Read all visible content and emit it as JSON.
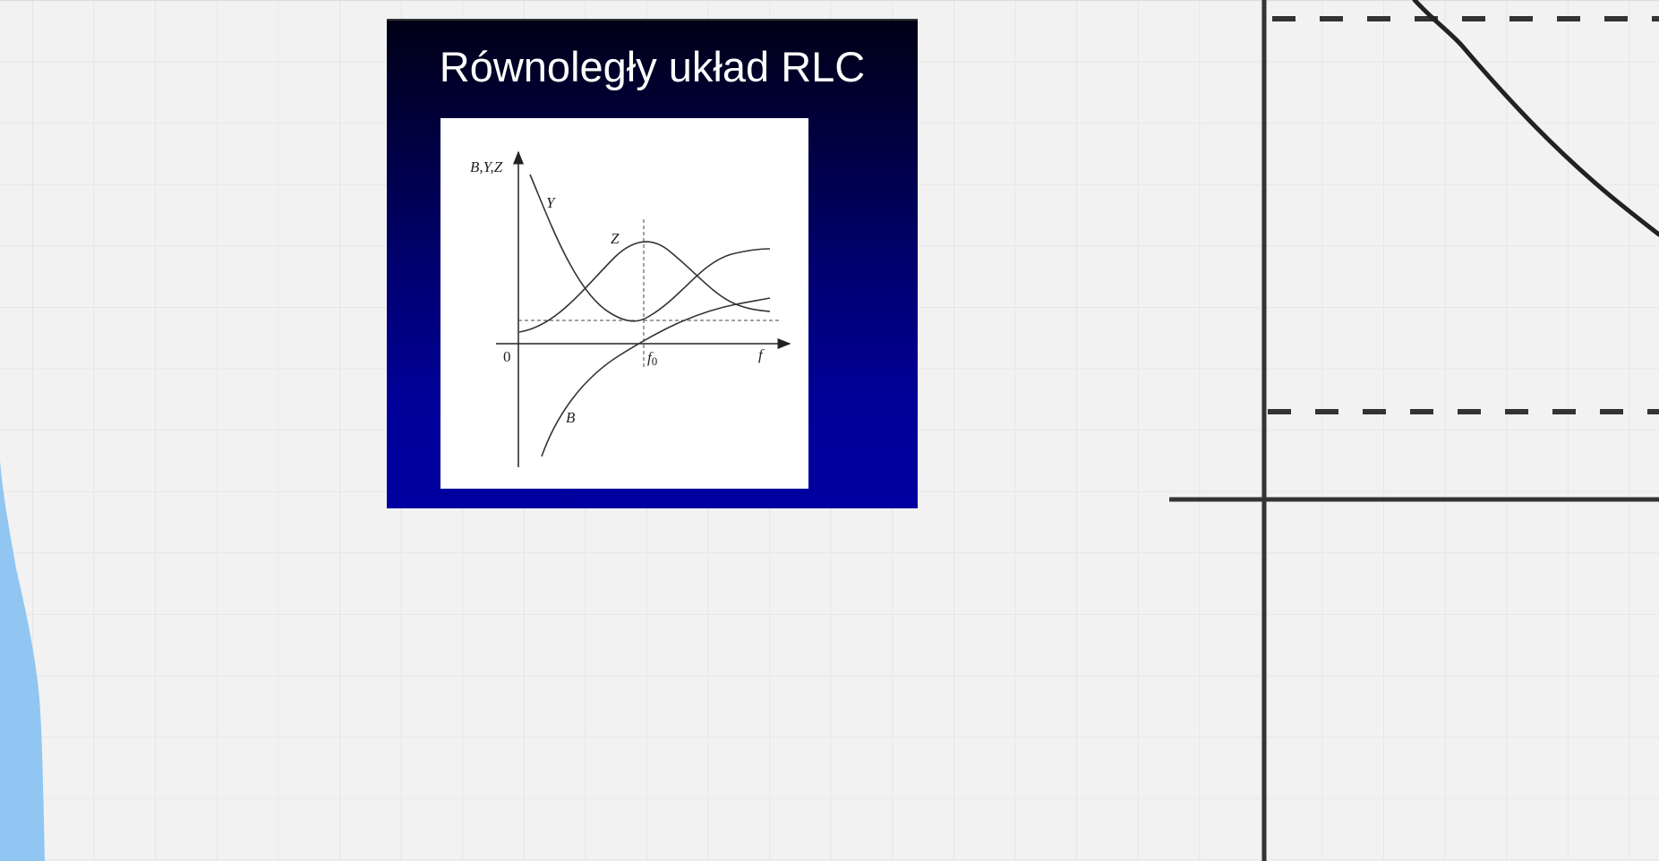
{
  "slide": {
    "title": "Równoległy układ RLC",
    "figure": {
      "y_axis_label": "B,Y,Z",
      "origin_label": "0",
      "x_axis_label": "f",
      "f0_label_base": "f",
      "f0_label_sub": "0",
      "curve_labels": {
        "Y": "Y",
        "Z": "Z",
        "B": "B"
      }
    }
  },
  "colors": {
    "canvas_background": "#f2f2f2",
    "grid_line": "#e6e6e6",
    "slide_top": "#000016",
    "slide_bottom": "#0000a0",
    "slide_title_text": "#ffffff",
    "sketch_stroke": "#333333",
    "blue_shape": "#90c6f1"
  }
}
